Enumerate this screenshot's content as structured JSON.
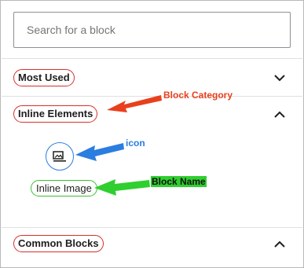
{
  "search": {
    "placeholder": "Search for a block",
    "value": ""
  },
  "categories": [
    {
      "label": "Most Used",
      "expanded": false,
      "chevron": "chevron-down-icon"
    },
    {
      "label": "Inline Elements",
      "expanded": true,
      "chevron": "chevron-up-icon"
    },
    {
      "label": "Common Blocks",
      "expanded": true,
      "chevron": "chevron-up-icon"
    }
  ],
  "inline_block": {
    "name": "Inline Image",
    "icon": "image-icon"
  },
  "annotations": {
    "category": "Block Category",
    "icon": "icon",
    "name": "Block Name"
  },
  "colors": {
    "category_annotation": "#e8401c",
    "icon_annotation": "#2b7de0",
    "name_annotation": "#2fcf2f"
  }
}
